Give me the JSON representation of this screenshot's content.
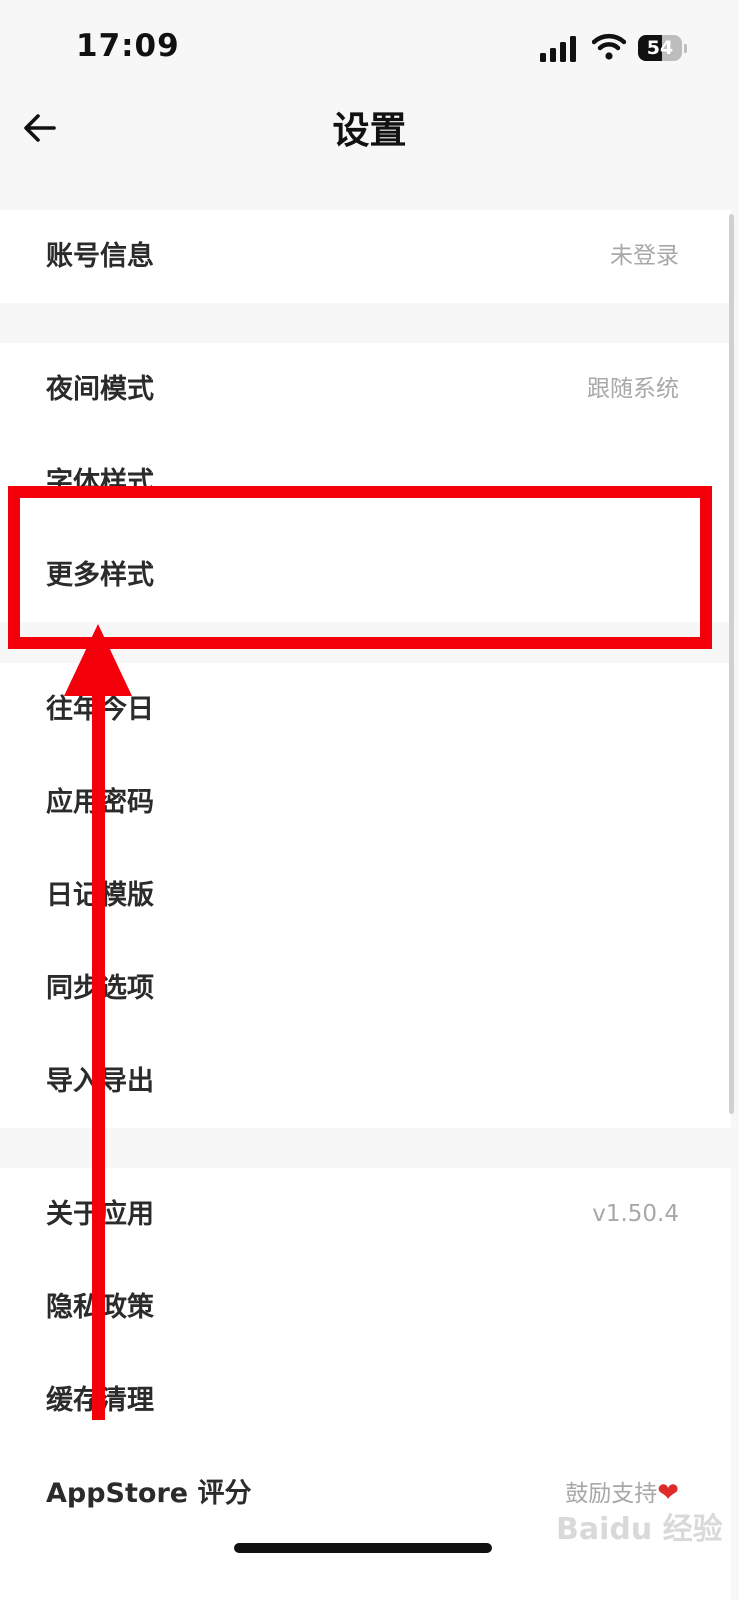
{
  "status_bar": {
    "time": "17:09",
    "battery": "54",
    "battery_level": 0.54
  },
  "nav": {
    "title": "设置"
  },
  "groups": [
    {
      "items": [
        {
          "label": "账号信息",
          "value": "未登录"
        }
      ]
    },
    {
      "items": [
        {
          "label": "夜间模式",
          "value": "跟随系统"
        },
        {
          "label": "字体样式",
          "value": ""
        },
        {
          "label": "更多样式",
          "value": ""
        }
      ]
    },
    {
      "items": [
        {
          "label": "往年今日",
          "value": ""
        },
        {
          "label": "应用密码",
          "value": ""
        },
        {
          "label": "日记模版",
          "value": ""
        },
        {
          "label": "同步选项",
          "value": ""
        },
        {
          "label": "导入导出",
          "value": ""
        }
      ]
    },
    {
      "items": [
        {
          "label": "关于应用",
          "value": "v1.50.4"
        },
        {
          "label": "隐私政策",
          "value": ""
        },
        {
          "label": "缓存清理",
          "value": ""
        },
        {
          "label": "AppStore 评分",
          "value": "鼓励支持",
          "value_icon": "❤"
        }
      ]
    }
  ],
  "watermark": "Baidu 经验",
  "colors": {
    "accent_red": "#f3000a",
    "page_bg": "#f7f7f7",
    "row_bg": "#ffffff",
    "label": "#2b2b2b",
    "value": "#a8a8a8"
  },
  "icons": {
    "back": "arrow-left-icon",
    "signal": "signal-icon",
    "wifi": "wifi-icon",
    "battery": "battery-icon",
    "heart": "heart-icon"
  }
}
